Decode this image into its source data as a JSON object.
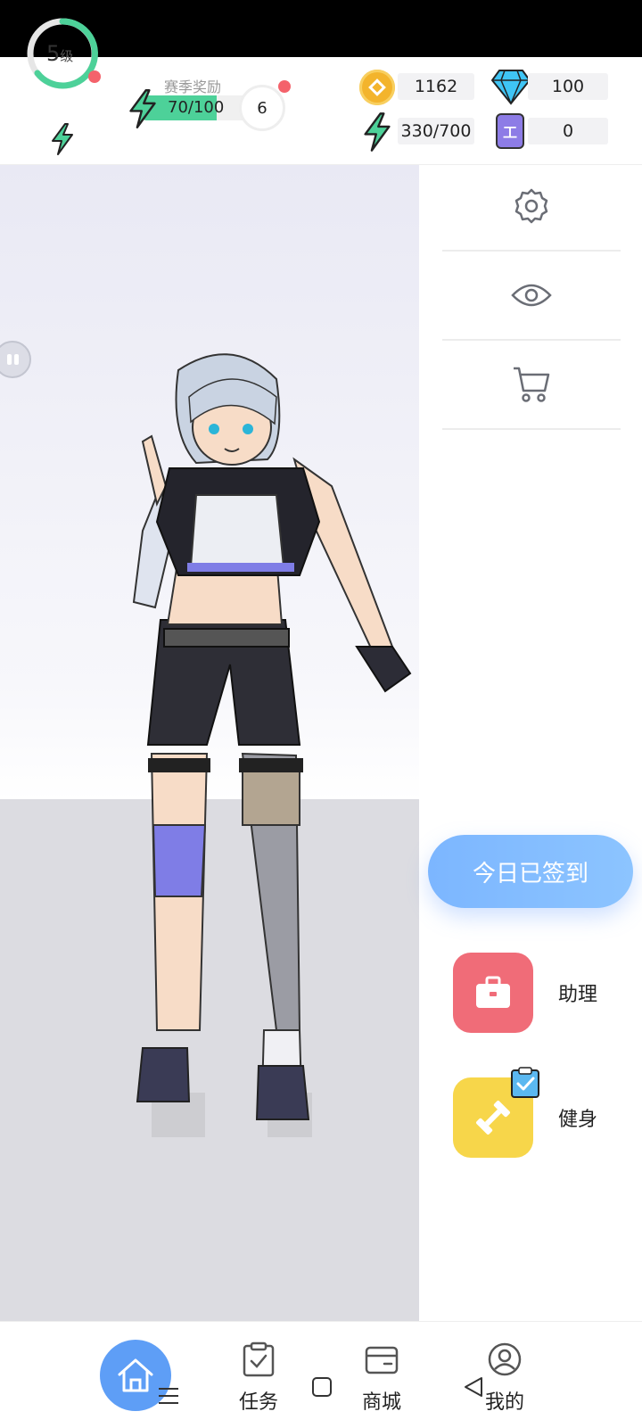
{
  "header": {
    "level_number": "5",
    "level_unit": "级",
    "season": {
      "title": "赛季奖励",
      "progress_text": "70/100",
      "progress": 0.7,
      "reward_count": "6"
    },
    "resources": {
      "coins": "1162",
      "diamonds": "100",
      "energy": "330/700",
      "tickets": "0",
      "ticket_glyph": "工"
    }
  },
  "sidebar": {
    "checkin_label": "今日已签到",
    "assistant_label": "助理",
    "fitness_label": "健身"
  },
  "nav": {
    "tasks_label": "任务",
    "store_label": "商城",
    "mine_label": "我的"
  },
  "colors": {
    "accent_green": "#4dd199",
    "primary_blue": "#5e9ef6",
    "checkin_blue": "#7cb6ff",
    "assistant_red": "#f06c78",
    "fitness_yellow": "#f7d64a",
    "badge_red": "#f4626b"
  }
}
